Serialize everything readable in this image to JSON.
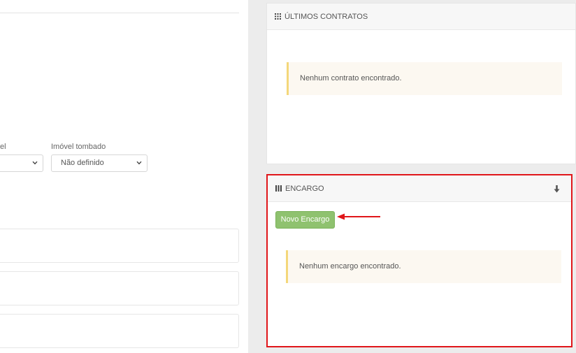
{
  "form": {
    "partial_field_label": "el",
    "field_label": "Imóvel tombado",
    "field_value": "Não definido"
  },
  "contracts_widget": {
    "title": "ÚLTIMOS CONTRATOS",
    "empty_message": "Nenhum contrato encontrado."
  },
  "encargo_widget": {
    "title": "ENCARGO",
    "new_button_label": "Novo Encargo",
    "empty_message": "Nenhum encargo encontrado."
  },
  "colors": {
    "highlight": "#e0161a",
    "button_green": "#8fc26f",
    "alert_border": "#f4d77a"
  },
  "icons": {
    "widget_header": "grid-icon",
    "collapse": "download-arrow-icon",
    "select": "chevron-down-icon"
  }
}
